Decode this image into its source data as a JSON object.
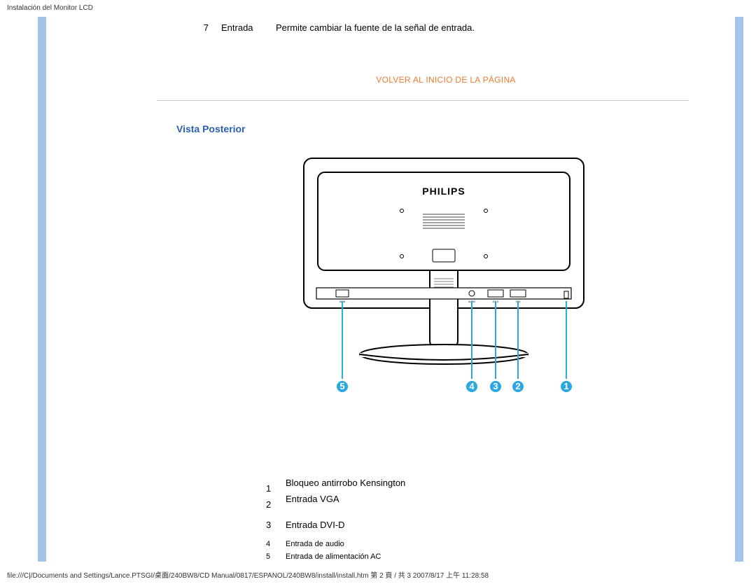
{
  "header": {
    "title": "Instalación del Monitor LCD"
  },
  "row7": {
    "num": "7",
    "label": "Entrada",
    "desc": "Permite cambiar la fuente de la señal de entrada."
  },
  "links": {
    "back_to_top": "VOLVER AL INICIO DE LA PÁGINA"
  },
  "section": {
    "vista_posterior": "Vista Posterior"
  },
  "monitor": {
    "brand": "PHILIPS",
    "port_labels": {
      "p5": "AC IN",
      "p4": "AUDIO",
      "p3": "DVI-D",
      "p2": "VGA",
      "p1": "KENSINGTON"
    }
  },
  "callouts": {
    "c1": "1",
    "c2": "2",
    "c3": "3",
    "c4": "4",
    "c5": "5"
  },
  "legend": {
    "r1_num": "1",
    "r1_text": "Bloqueo antirrobo Kensington",
    "r2_num": "2",
    "r2_text": "Entrada VGA",
    "r3_num": "3",
    "r3_text": "Entrada DVI-D",
    "r4_num": "4",
    "r4_text": "Entrada de audio",
    "r5_num": "5",
    "r5_text": "Entrada de alimentación AC"
  },
  "footer": {
    "path": "file:///C|/Documents and Settings/Lance.PTSGI/桌面/240BW8/CD Manual/0817/ESPANOL/240BW8/install/install.htm 第 2 頁 / 共 3 2007/8/17 上午 11:28:58"
  }
}
